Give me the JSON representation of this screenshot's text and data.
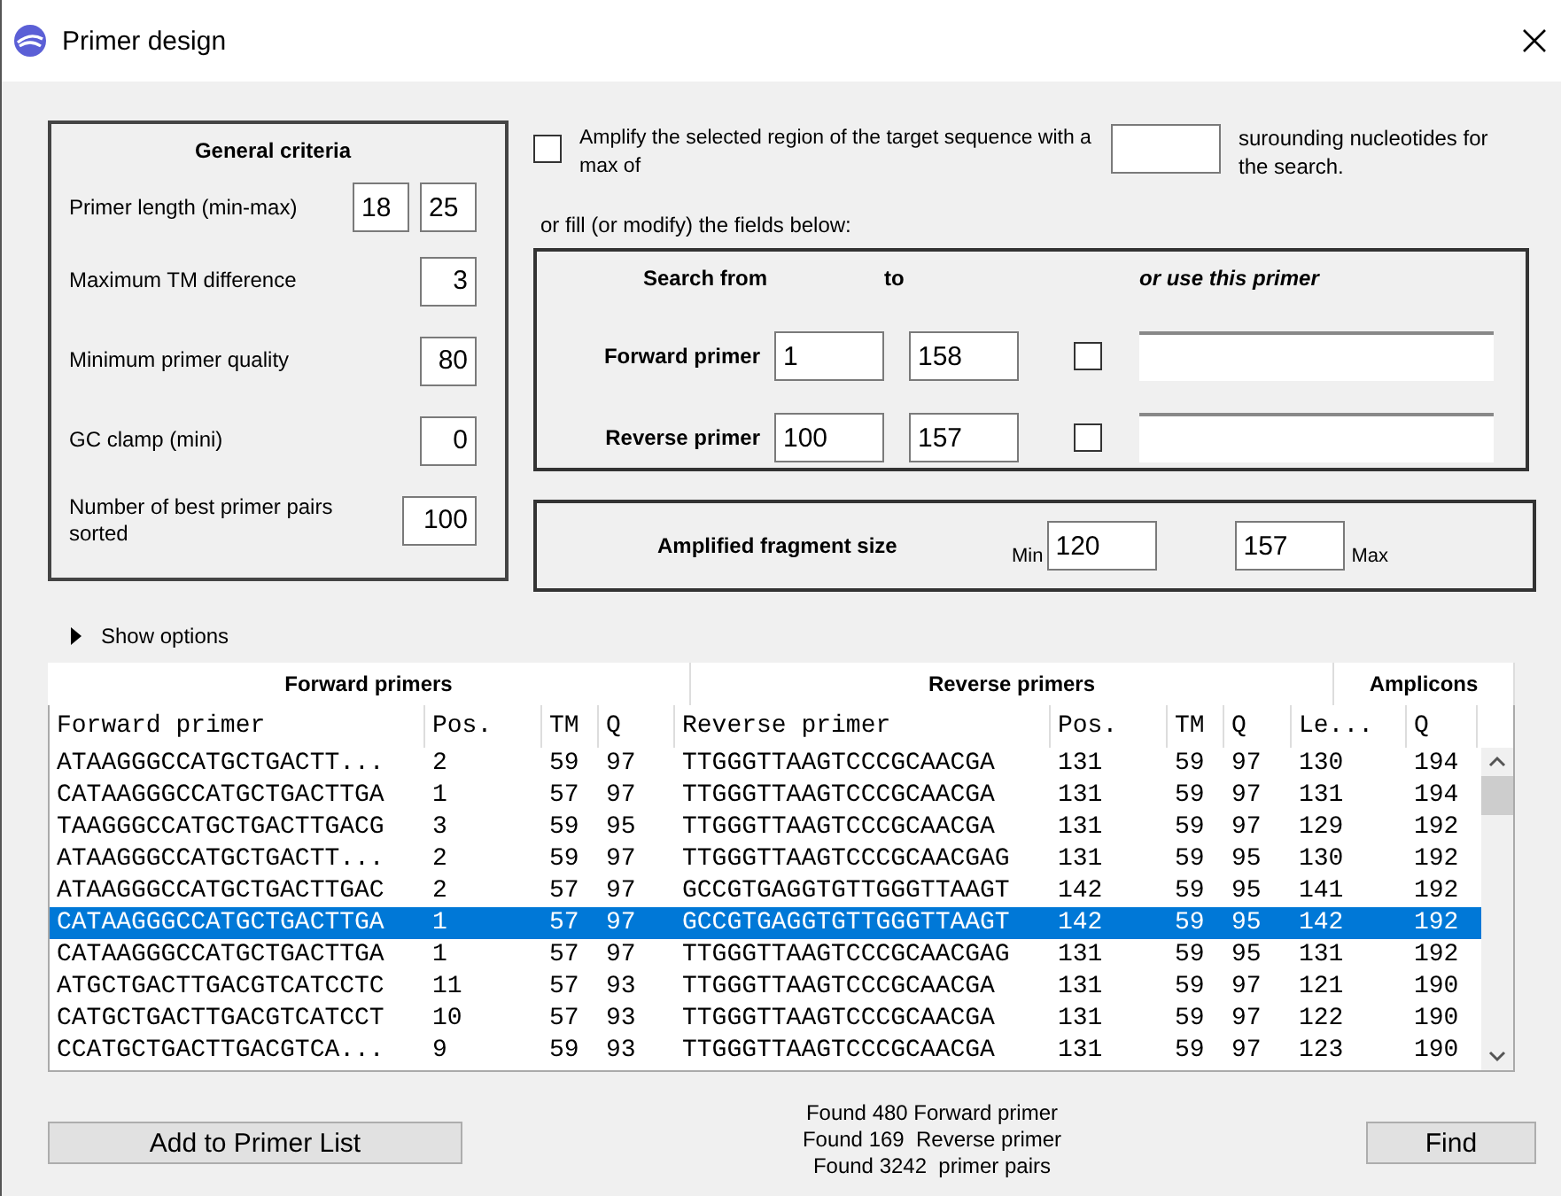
{
  "window": {
    "title": "Primer design"
  },
  "general_criteria": {
    "title": "General criteria",
    "fields": [
      {
        "label": "Primer length (min-max)",
        "values": [
          "18",
          "25"
        ]
      },
      {
        "label": "Maximum TM difference",
        "values": [
          "3"
        ]
      },
      {
        "label": "Minimum primer quality",
        "values": [
          "80"
        ]
      },
      {
        "label": "GC clamp (mini)",
        "values": [
          "0"
        ]
      },
      {
        "label": "Number of best primer pairs sorted",
        "values": [
          "100"
        ]
      }
    ]
  },
  "amplify": {
    "checked": false,
    "label": "Amplify the selected region of the target sequence with a max of",
    "suffix": "surounding nucleotides for the search."
  },
  "fill_hint": "or fill (or modify) the fields below:",
  "search": {
    "headers": [
      "Search from",
      "to",
      "or use this primer"
    ],
    "rows": [
      {
        "label": "Forward primer",
        "from": "1",
        "to": "158",
        "use_primer": false
      },
      {
        "label": "Reverse primer",
        "from": "100",
        "to": "157",
        "use_primer": false
      }
    ]
  },
  "fragment": {
    "label": "Amplified fragment size",
    "min_label": "Min",
    "min": "120",
    "max": "157",
    "max_label": "Max"
  },
  "show_options": {
    "label": "Show options",
    "expanded": false
  },
  "table": {
    "groups": [
      "Forward primers",
      "Reverse primers",
      "Amplicons"
    ],
    "columns": [
      "Forward primer",
      "Pos.",
      "TM",
      "Q",
      "Reverse primer",
      "Pos.",
      "TM",
      "Q",
      "Le...",
      "Q"
    ],
    "rows": [
      {
        "selected": false,
        "cells": [
          "ATAAGGGCCATGCTGACTT...",
          "2",
          "59",
          "97",
          "TTGGGTTAAGTCCCGCAACGA",
          "131",
          "59",
          "97",
          "130",
          "194"
        ]
      },
      {
        "selected": false,
        "cells": [
          "CATAAGGGCCATGCTGACTTGA",
          "1",
          "57",
          "97",
          "TTGGGTTAAGTCCCGCAACGA",
          "131",
          "59",
          "97",
          "131",
          "194"
        ]
      },
      {
        "selected": false,
        "cells": [
          "TAAGGGCCATGCTGACTTGACG",
          "3",
          "59",
          "95",
          "TTGGGTTAAGTCCCGCAACGA",
          "131",
          "59",
          "97",
          "129",
          "192"
        ]
      },
      {
        "selected": false,
        "cells": [
          "ATAAGGGCCATGCTGACTT...",
          "2",
          "59",
          "97",
          "TTGGGTTAAGTCCCGCAACGAG",
          "131",
          "59",
          "95",
          "130",
          "192"
        ]
      },
      {
        "selected": false,
        "cells": [
          "ATAAGGGCCATGCTGACTTGAC",
          "2",
          "57",
          "97",
          "GCCGTGAGGTGTTGGGTTAAGT",
          "142",
          "59",
          "95",
          "141",
          "192"
        ]
      },
      {
        "selected": true,
        "cells": [
          "CATAAGGGCCATGCTGACTTGA",
          "1",
          "57",
          "97",
          "GCCGTGAGGTGTTGGGTTAAGT",
          "142",
          "59",
          "95",
          "142",
          "192"
        ]
      },
      {
        "selected": false,
        "cells": [
          "CATAAGGGCCATGCTGACTTGA",
          "1",
          "57",
          "97",
          "TTGGGTTAAGTCCCGCAACGAG",
          "131",
          "59",
          "95",
          "131",
          "192"
        ]
      },
      {
        "selected": false,
        "cells": [
          "ATGCTGACTTGACGTCATCCTC",
          "11",
          "57",
          "93",
          "TTGGGTTAAGTCCCGCAACGA",
          "131",
          "59",
          "97",
          "121",
          "190"
        ]
      },
      {
        "selected": false,
        "cells": [
          "CATGCTGACTTGACGTCATCCT",
          "10",
          "57",
          "93",
          "TTGGGTTAAGTCCCGCAACGA",
          "131",
          "59",
          "97",
          "122",
          "190"
        ]
      },
      {
        "selected": false,
        "cells": [
          "CCATGCTGACTTGACGTCA...",
          "9",
          "59",
          "93",
          "TTGGGTTAAGTCCCGCAACGA",
          "131",
          "59",
          "97",
          "123",
          "190"
        ]
      }
    ]
  },
  "status": [
    "Found 480 Forward primer",
    "Found 169  Reverse primer",
    "Found 3242  primer pairs"
  ],
  "buttons": {
    "add": "Add to Primer List",
    "find": "Find"
  }
}
